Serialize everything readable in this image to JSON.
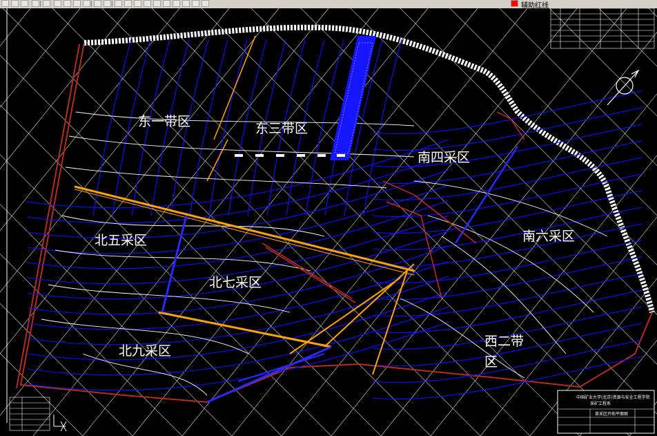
{
  "window": {
    "title": ""
  },
  "toolbar": {
    "buttons": [
      {
        "icon": "folder-icon"
      },
      {
        "icon": "save-icon"
      },
      {
        "icon": "print-icon"
      },
      {
        "icon": "print-preview-icon"
      },
      {
        "icon": "publish-icon"
      },
      {
        "icon": "cut-icon"
      },
      {
        "icon": "copy-icon"
      },
      {
        "icon": "paste-icon"
      },
      {
        "icon": "match-properties-icon"
      },
      {
        "icon": "undo-icon"
      },
      {
        "icon": "redo-icon"
      },
      {
        "icon": "pan-icon"
      },
      {
        "icon": "zoom-realtime-icon"
      },
      {
        "icon": "zoom-window-icon"
      },
      {
        "icon": "zoom-previous-icon"
      },
      {
        "icon": "properties-icon"
      },
      {
        "icon": "design-center-icon"
      },
      {
        "icon": "tool-palette-icon"
      },
      {
        "icon": "help-icon"
      },
      {
        "icon": "layer-icon"
      },
      {
        "icon": "layer-state-icon"
      }
    ],
    "layer_name": "辅助红线",
    "layer_color": "#ff0000"
  },
  "drawing": {
    "zones": [
      {
        "name": "zone-dong-yi",
        "label": "东一带区"
      },
      {
        "name": "zone-dong-san",
        "label": "东三带区"
      },
      {
        "name": "zone-nan-si",
        "label": "南四采区"
      },
      {
        "name": "zone-nan-liu",
        "label": "南六采区"
      },
      {
        "name": "zone-bei-wu",
        "label": "北五采区"
      },
      {
        "name": "zone-bei-qi",
        "label": "北七采区"
      },
      {
        "name": "zone-bei-jiu",
        "label": "北九采区"
      },
      {
        "name": "zone-xi-er-line1",
        "label": "西二带"
      },
      {
        "name": "zone-xi-er-line2",
        "label": "区"
      }
    ],
    "title_block": {
      "line1": "中国矿业大学(北京)资源与安全工程学院",
      "line2": "采矿工程系",
      "drawing_title": "首采区开拓平面图"
    },
    "colors": {
      "background": "#000000",
      "contour": "#ffffff",
      "coal_seam": "#1010ff",
      "roadway": "#ffa500",
      "boundary": "#b03020",
      "grid": "#ffffff"
    }
  }
}
